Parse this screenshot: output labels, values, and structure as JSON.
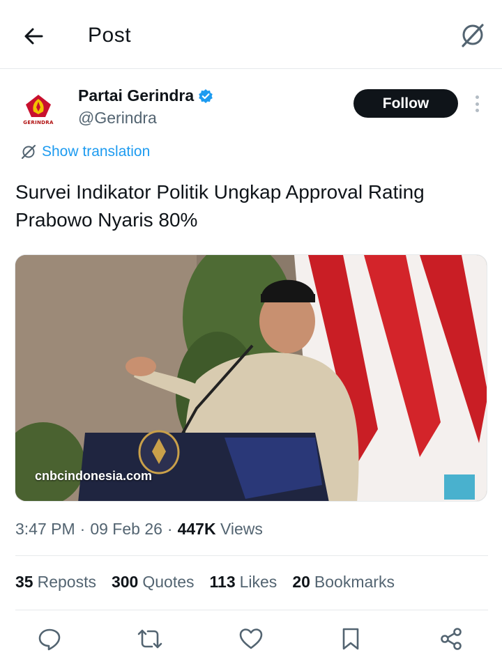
{
  "header": {
    "title": "Post"
  },
  "author": {
    "display_name": "Partai Gerindra",
    "handle": "@Gerindra",
    "avatar_text": "GERINDRA",
    "verified": true
  },
  "follow_label": "Follow",
  "translate_label": "Show translation",
  "tweet_text": "Survei Indikator Politik Ungkap Approval Rating Prabowo Nyaris 80%",
  "media": {
    "source_label": "cnbcindonesia.com"
  },
  "meta": {
    "time": "3:47 PM",
    "sep1": "·",
    "date": "09 Feb 26",
    "sep2": "·",
    "views_count": "447K",
    "views_label": "Views"
  },
  "stats": {
    "reposts": {
      "count": "35",
      "label": "Reposts"
    },
    "quotes": {
      "count": "300",
      "label": "Quotes"
    },
    "likes": {
      "count": "113",
      "label": "Likes"
    },
    "bookmarks": {
      "count": "20",
      "label": "Bookmarks"
    }
  },
  "colors": {
    "accent": "#1d9bf0",
    "text": "#0f1419",
    "muted": "#536471",
    "divider": "#e6e9eb",
    "follow_bg": "#0f1419"
  },
  "icons": [
    "back-arrow-icon",
    "grok-icon",
    "verified-badge-icon",
    "more-icon",
    "translate-icon",
    "reply-icon",
    "repost-icon",
    "like-icon",
    "bookmark-icon",
    "share-icon"
  ]
}
